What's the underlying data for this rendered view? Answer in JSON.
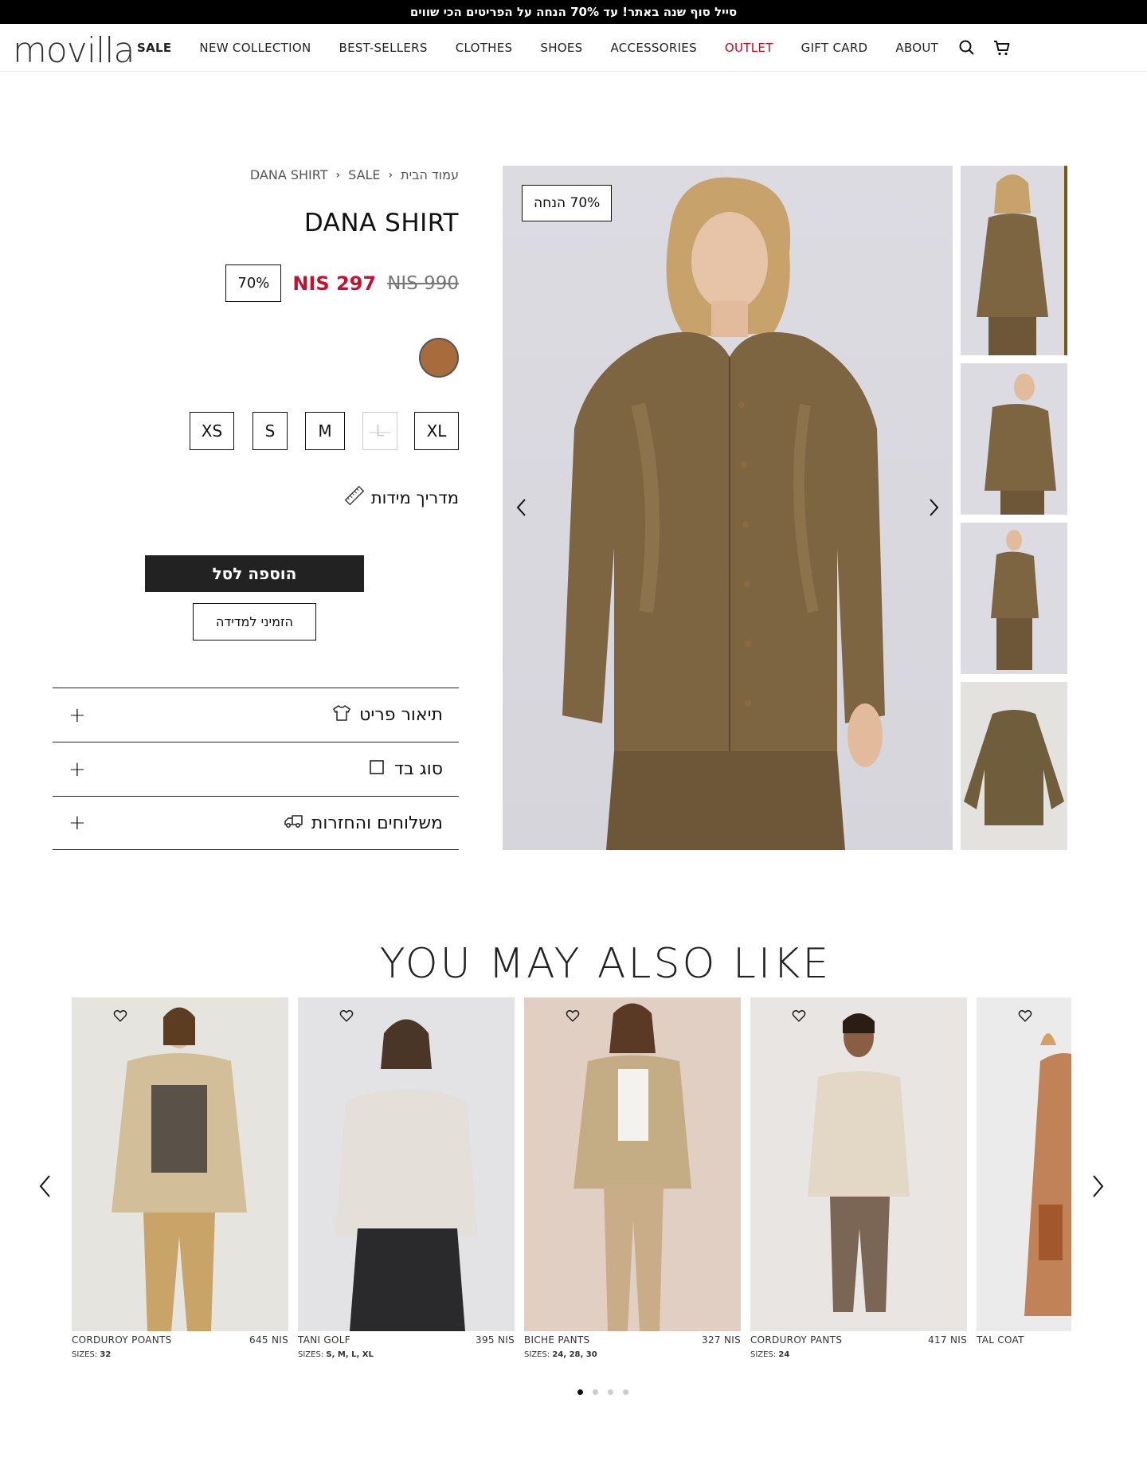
{
  "announcement": "סייל סוף שנה באתר! עד 70% הנחה על הפריטים הכי שווים",
  "header": {
    "logo": "movilla",
    "nav": [
      "SALE",
      "NEW COLLECTION",
      "BEST-SELLERS",
      "CLOTHES",
      "SHOES",
      "ACCESSORIES",
      "OUTLET",
      "GIFT CARD",
      "ABOUT"
    ],
    "icons": [
      "search-icon",
      "cart-icon"
    ]
  },
  "product": {
    "breadcrumb": [
      "עמוד הבית",
      "SALE",
      "DANA SHIRT"
    ],
    "title": "DANA SHIRT",
    "old_price": "990 NIS",
    "new_price": "297 NIS",
    "discount": "70%",
    "image_badge": "70% הנחה",
    "swatch_color": "#a86b3c",
    "sizes": [
      {
        "label": "XS",
        "available": true
      },
      {
        "label": "S",
        "available": true
      },
      {
        "label": "M",
        "available": true
      },
      {
        "label": "L",
        "available": false
      },
      {
        "label": "XL",
        "available": true
      }
    ],
    "size_guide": "מדריך מידות",
    "add_to_cart": "הוספה לסל",
    "book_fitting": "הזמיני למדידה",
    "accordion": [
      "תיאור פריט",
      "סוג בד",
      "משלוחים והחזרות"
    ]
  },
  "recommendations": {
    "title": "YOU MAY ALSO LIKE",
    "items": [
      {
        "name": "CORDUROY POANTS",
        "price": "645 NIS",
        "sizes_label": "SIZES:",
        "sizes": "32"
      },
      {
        "name": "TANI GOLF",
        "price": "395 NIS",
        "sizes_label": "SIZES:",
        "sizes": "S, M, L, XL"
      },
      {
        "name": "BICHE PANTS",
        "price": "327 NIS",
        "sizes_label": "SIZES:",
        "sizes": "24, 28, 30"
      },
      {
        "name": "CORDUROY PANTS",
        "price": "417 NIS",
        "sizes_label": "SIZES:",
        "sizes": "24"
      },
      {
        "name": "TAL COAT",
        "price": "",
        "sizes_label": "",
        "sizes": ""
      }
    ],
    "pagination": 4,
    "active_page": 1
  },
  "colors": {
    "accent_red": "#c8102e",
    "outlet_red": "#d0021b",
    "thumb_border": "#7a5a12"
  }
}
